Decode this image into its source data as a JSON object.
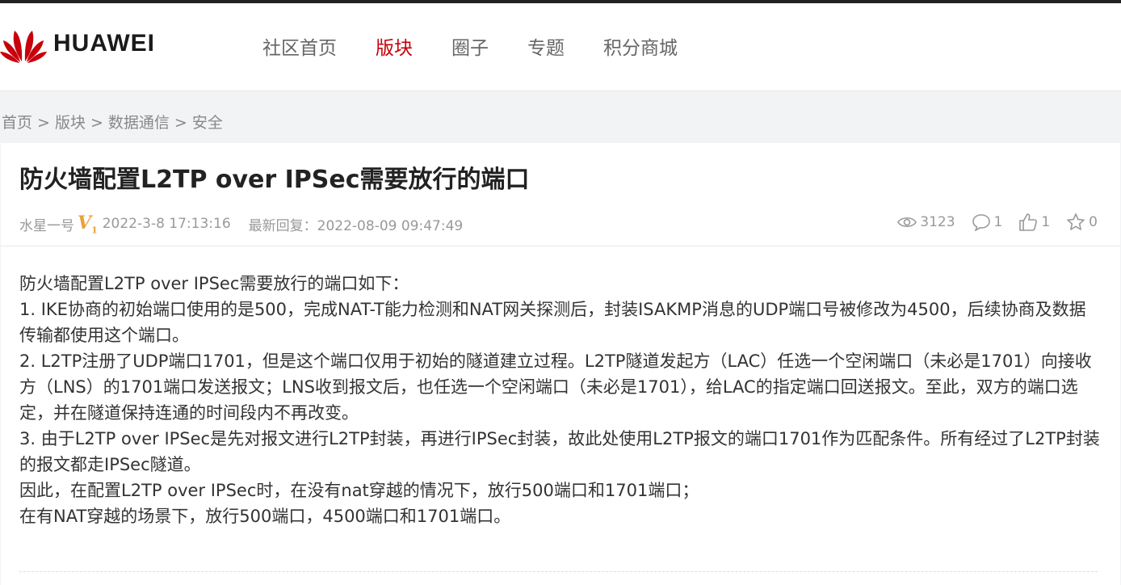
{
  "brand": {
    "name": "HUAWEI",
    "logo_color": "#c7000b"
  },
  "nav": {
    "items": [
      {
        "label": "社区首页",
        "active": false
      },
      {
        "label": "版块",
        "active": true
      },
      {
        "label": "圈子",
        "active": false
      },
      {
        "label": "专题",
        "active": false
      },
      {
        "label": "积分商城",
        "active": false
      }
    ]
  },
  "breadcrumb": [
    "首页",
    "版块",
    "数据通信",
    "安全"
  ],
  "breadcrumb_sep": ">",
  "post": {
    "title": "防火墙配置L2TP over IPSec需要放行的端口",
    "author": "水星一号",
    "level": "V",
    "level_num": "1",
    "post_time": "2022-3-8 17:13:16",
    "reply_time": "最新回复：2022-08-09 09:47:49",
    "stats": {
      "views": "3123",
      "comments": "1",
      "likes": "1",
      "favorites": "0"
    },
    "content": [
      "防火墙配置L2TP over IPSec需要放行的端口如下：",
      "1. IKE协商的初始端口使用的是500，完成NAT-T能力检测和NAT网关探测后，封装ISAKMP消息的UDP端口号被修改为4500，后续协商及数据传输都使用这个端口。",
      "2. L2TP注册了UDP端口1701，但是这个端口仅用于初始的隧道建立过程。L2TP隧道发起方（LAC）任选一个空闲端口（未必是1701）向接收方（LNS）的1701端口发送报文；LNS收到报文后，也任选一个空闲端口（未必是1701），给LAC的指定端口回送报文。至此，双方的端口选定，并在隧道保持连通的时间段内不再改变。",
      "3. 由于L2TP over IPSec是先对报文进行L2TP封装，再进行IPSec封装，故此处使用L2TP报文的端口1701作为匹配条件。所有经过了L2TP封装的报文都走IPSec隧道。",
      "因此，在配置L2TP over IPSec时，在没有nat穿越的情况下，放行500端口和1701端口；",
      "在有NAT穿越的场景下，放行500端口，4500端口和1701端口。"
    ]
  },
  "icons": {
    "logo": "huawei-logo-icon",
    "views": "eye-icon",
    "comments": "comment-icon",
    "likes": "thumbs-up-icon",
    "favorites": "star-icon"
  }
}
